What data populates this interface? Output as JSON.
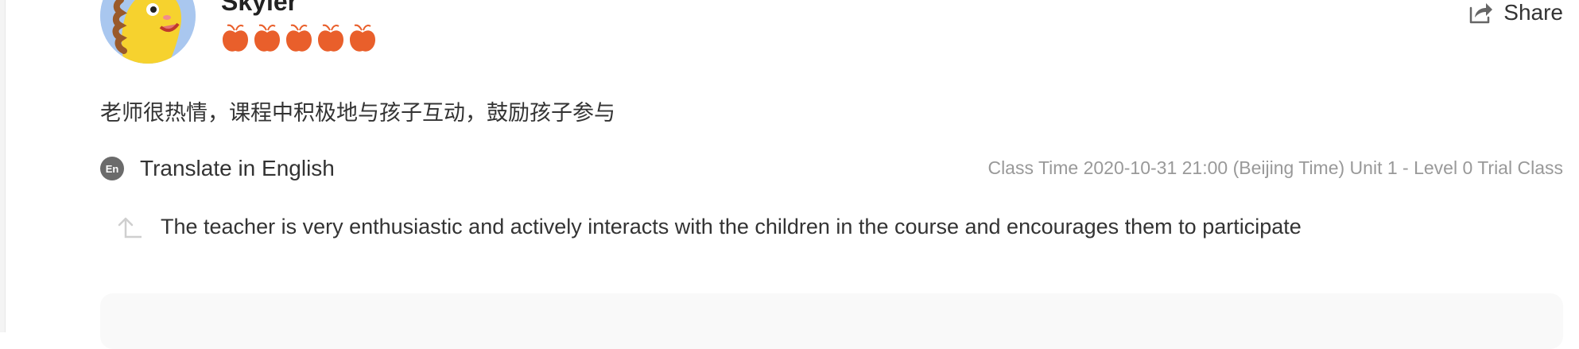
{
  "review": {
    "username": "Skyler",
    "rating": {
      "value": 5,
      "max": 5,
      "icon": "apple-icon",
      "color": "#e95f2b"
    },
    "share_label": "Share",
    "comment": "老师很热情，课程中积极地与孩子互动，鼓励孩子参与",
    "translate_label": "Translate in English",
    "translate_badge": "En",
    "class_time": "Class Time 2020-10-31 21:00 (Beijing Time) Unit 1 - Level 0 Trial Class",
    "translation": "The teacher is very enthusiastic and actively interacts with the children in the course and encourages them to participate"
  },
  "colors": {
    "accent_apple": "#e95f2b",
    "text_primary": "#333333",
    "text_muted": "#999999",
    "avatar_bg": "#a9c7ef"
  }
}
